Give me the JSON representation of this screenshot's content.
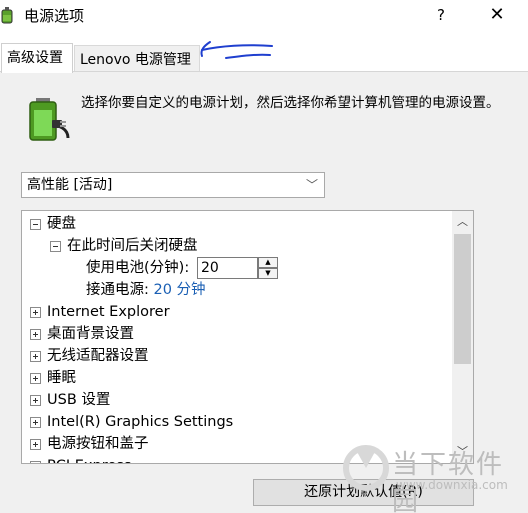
{
  "window": {
    "title": "电源选项",
    "help_label": "?",
    "close_label": "✕"
  },
  "tabs": [
    {
      "label": "高级设置",
      "active": true
    },
    {
      "label": "Lenovo 电源管理",
      "active": false
    }
  ],
  "description": "选择你要自定义的电源计划，然后选择你希望计算机管理的电源设置。",
  "plan_select": {
    "value": "高性能 [活动]"
  },
  "tree": {
    "items": [
      {
        "label": "硬盘",
        "expanded": true
      },
      {
        "label": "在此时间后关闭硬盘",
        "expanded": true
      },
      {
        "label": "使用电池(分钟):",
        "value": "20"
      },
      {
        "label": "接通电源:",
        "value": "20 分钟"
      },
      {
        "label": "Internet Explorer",
        "expanded": false
      },
      {
        "label": "桌面背景设置",
        "expanded": false
      },
      {
        "label": "无线适配器设置",
        "expanded": false
      },
      {
        "label": "睡眠",
        "expanded": false
      },
      {
        "label": "USB 设置",
        "expanded": false
      },
      {
        "label": "Intel(R) Graphics Settings",
        "expanded": false
      },
      {
        "label": "电源按钮和盖子",
        "expanded": false
      },
      {
        "label": "PCI Express",
        "expanded": false
      }
    ]
  },
  "buttons": {
    "restore_label": "还原计划默认值(R)"
  },
  "watermark": {
    "text": "当下软件园",
    "url": "www.downxia.com"
  },
  "colors": {
    "link": "#1a5fb4",
    "annotation": "#1f3fcf",
    "panel_bg": "#f0f0f0"
  },
  "icons": {
    "app": "battery-power-icon",
    "description": "battery-plug-icon",
    "close": "close-icon",
    "help": "help-icon"
  }
}
